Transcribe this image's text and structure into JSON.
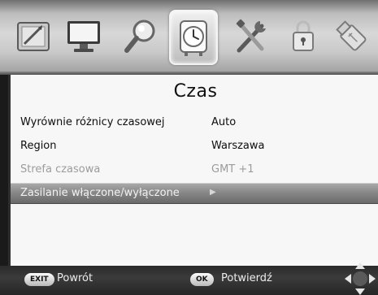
{
  "menu": {
    "icons": [
      {
        "name": "picture-settings-icon",
        "selected": false
      },
      {
        "name": "display-settings-icon",
        "selected": false
      },
      {
        "name": "search-icon",
        "selected": false
      },
      {
        "name": "clock-icon",
        "selected": true
      },
      {
        "name": "tools-icon",
        "selected": false
      },
      {
        "name": "lock-icon",
        "selected": false
      },
      {
        "name": "usb-icon",
        "selected": false
      }
    ]
  },
  "panel": {
    "title": "Czas",
    "rows": [
      {
        "label": "Wyrównie różnicy czasowej",
        "value": "Auto",
        "state": "normal"
      },
      {
        "label": "Region",
        "value": "Warszawa",
        "state": "normal"
      },
      {
        "label": "Strefa czasowa",
        "value": "GMT +1",
        "state": "disabled"
      },
      {
        "label": "Zasilanie włączone/wyłączone",
        "value": "",
        "state": "highlighted"
      }
    ]
  },
  "footer": {
    "exit_key": "EXIT",
    "exit_label": "Powrót",
    "ok_key": "OK",
    "ok_label": "Potwierdź",
    "nav_icon": "dpad-icon"
  }
}
